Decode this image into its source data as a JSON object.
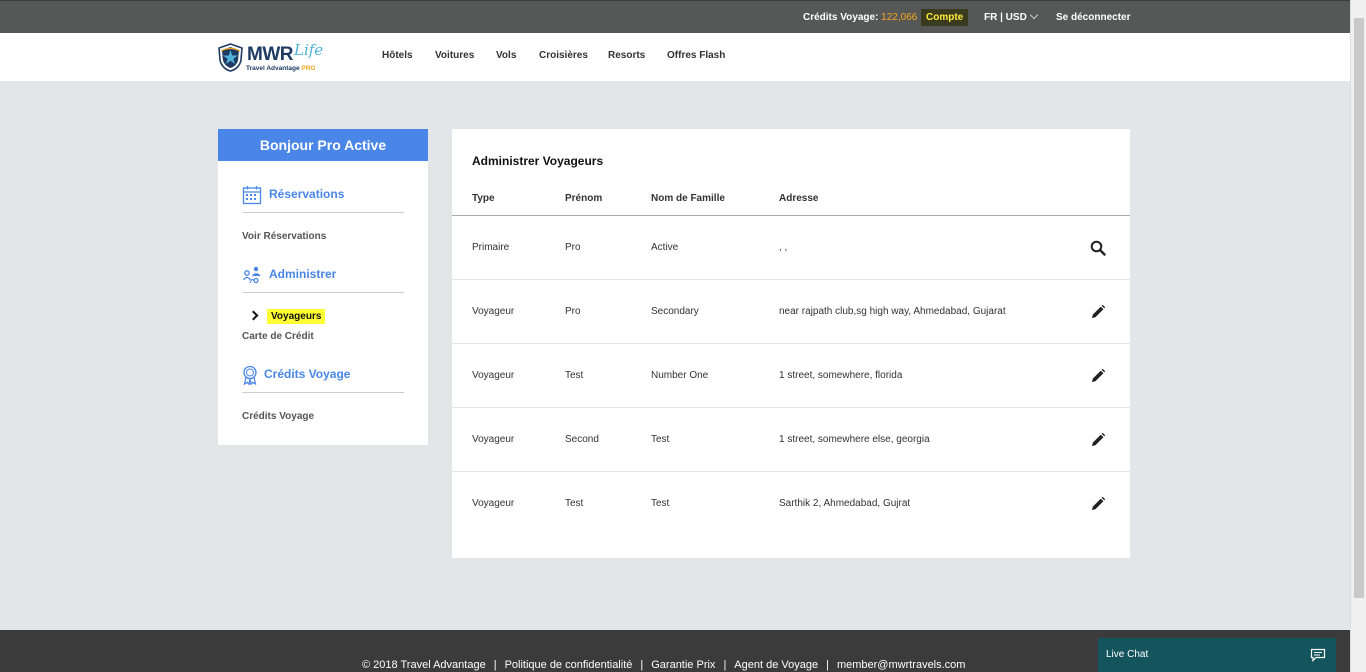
{
  "topbar": {
    "credits_label": "Crédits Voyage:",
    "credits_amount": "122,066",
    "account": "Compte",
    "language": "FR | USD",
    "logout": "Se déconnecter"
  },
  "logo": {
    "brand": "MWR",
    "script": "Life",
    "tagline": "Travel Advantage",
    "tagline_pro": "PRO"
  },
  "nav": {
    "items": [
      "Hôtels",
      "Voitures",
      "Vols",
      "Croisières",
      "Resorts",
      "Offres Flash"
    ]
  },
  "sidebar": {
    "greeting": "Bonjour Pro Active",
    "sections": [
      {
        "title": "Réservations",
        "icon": "calendar-icon",
        "links": [
          "Voir Réservations"
        ]
      },
      {
        "title": "Administrer",
        "icon": "people-icon",
        "active": "Voyageurs",
        "links": [
          "Carte de Crédit"
        ]
      },
      {
        "title": "Crédits Voyage",
        "icon": "ribbon-icon",
        "links": [
          "Crédits Voyage"
        ]
      }
    ]
  },
  "main": {
    "title": "Administrer Voyageurs",
    "columns": [
      "Type",
      "Prénom",
      "Nom de Famille",
      "Adresse"
    ],
    "rows": [
      {
        "type": "Primaire",
        "first": "Pro",
        "last": "Active",
        "address": ", ,",
        "action": "search-icon"
      },
      {
        "type": "Voyageur",
        "first": "Pro",
        "last": "Secondary",
        "address": "near rajpath club,sg high way, Ahmedabad, Gujarat",
        "action": "pencil-icon"
      },
      {
        "type": "Voyageur",
        "first": "Test",
        "last": "Number One",
        "address": "1 street, somewhere, florida",
        "action": "pencil-icon"
      },
      {
        "type": "Voyageur",
        "first": "Second",
        "last": "Test",
        "address": "1 street, somewhere else, georgia",
        "action": "pencil-icon"
      },
      {
        "type": "Voyageur",
        "first": "Test",
        "last": "Test",
        "address": "Sarthik 2, Ahmedabad, Gujrat",
        "action": "pencil-icon"
      }
    ]
  },
  "footer": {
    "copyright": "© 2018 Travel Advantage",
    "links": [
      "Politique de confidentialité",
      "Garantie Prix",
      "Agent de Voyage",
      "member@mwrtravels.com"
    ]
  },
  "livechat": {
    "label": "Live Chat"
  },
  "colors": {
    "accent": "#4a86e8",
    "topbar": "#555856",
    "highlight": "#ffff33",
    "credits": "#f5a623",
    "livechat": "#14545d"
  }
}
